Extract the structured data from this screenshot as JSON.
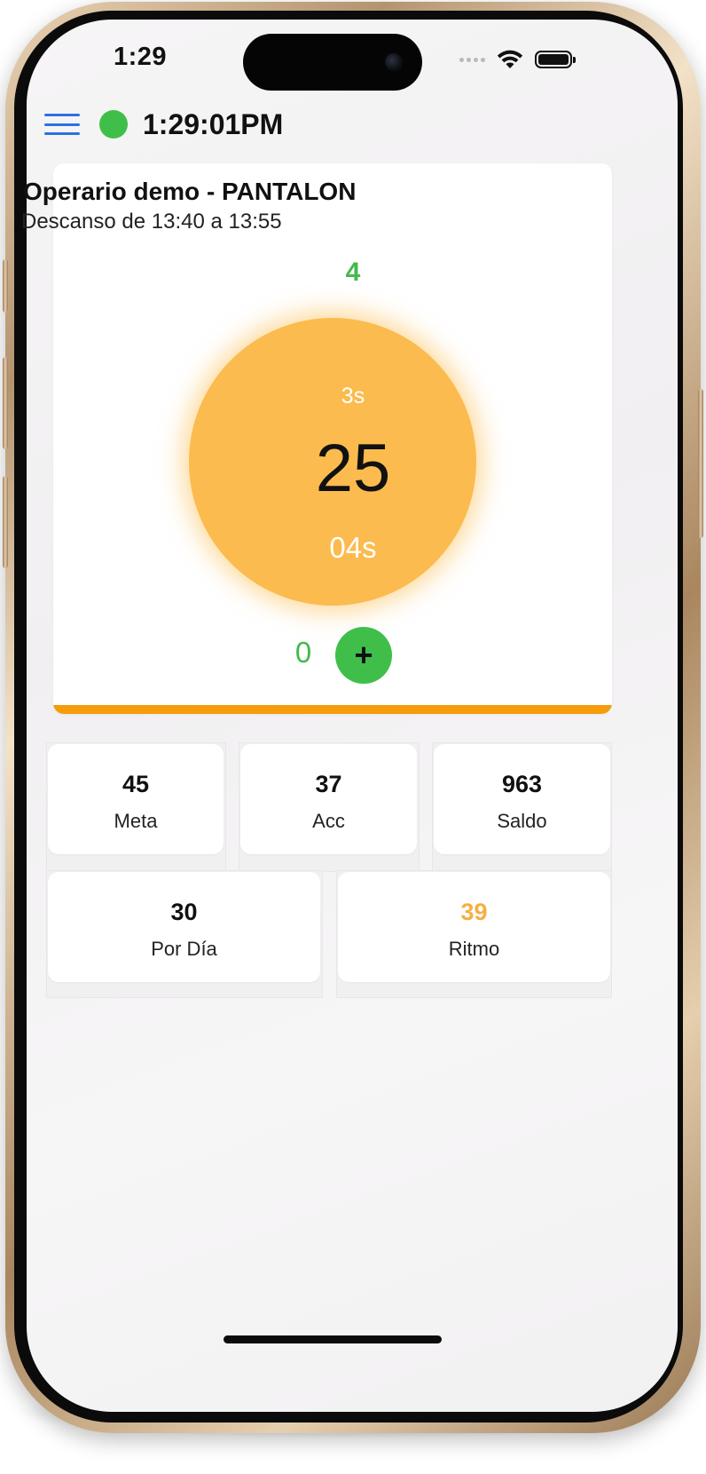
{
  "status_bar": {
    "time": "1:29",
    "icons": [
      "signal-dots-icon",
      "wifi-icon",
      "battery-icon"
    ]
  },
  "header": {
    "menu_icon": "hamburger-menu-icon",
    "connection_status_color": "#3fbf4a",
    "clock": "1:29:01PM"
  },
  "card": {
    "title": "Operario demo - PANTALON",
    "subtitle": "Descanso de 13:40 a 13:55",
    "top_count": "4",
    "timer": {
      "top_label": "3s",
      "value": "25",
      "bottom_label": "04s",
      "color": "#fbbb4e"
    },
    "bottom_count": "0",
    "add_button_label": "+",
    "accent_bar_color": "#f59c0a"
  },
  "stats": [
    {
      "value": "45",
      "label": "Meta"
    },
    {
      "value": "37",
      "label": "Acc"
    },
    {
      "value": "963",
      "label": "Saldo"
    },
    {
      "value": "30",
      "label": "Por Día"
    },
    {
      "value": "39",
      "label": "Ritmo",
      "value_color": "#f5b042"
    }
  ],
  "colors": {
    "green": "#44b94c",
    "orange": "#f59c0a",
    "blue": "#2f6fe3"
  }
}
